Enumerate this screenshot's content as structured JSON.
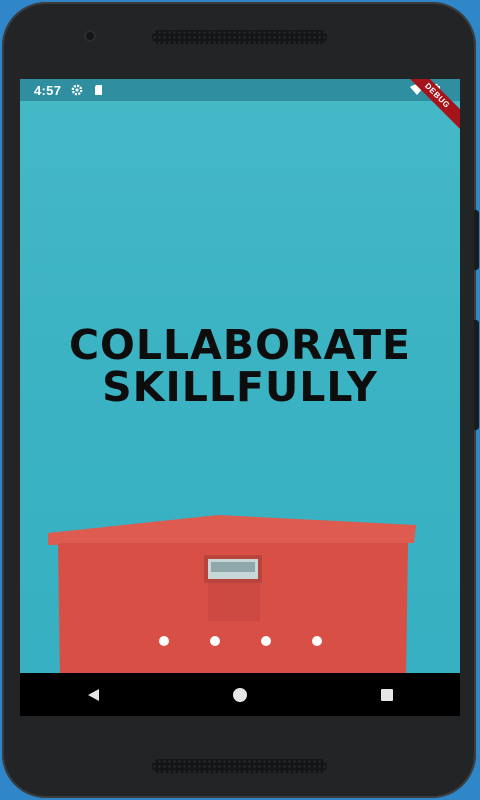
{
  "status_bar": {
    "time": "4:57",
    "icons": [
      "gear-icon",
      "sd-card-icon",
      "wifi-icon",
      "battery-icon"
    ]
  },
  "debug_banner": "DEBUG",
  "slide": {
    "line1": "COLLABORATE",
    "line2": "SKILLFULLY"
  },
  "page_indicator": {
    "count": 4
  },
  "nav_bar": {
    "buttons": [
      "back-icon",
      "home-icon",
      "recents-icon"
    ]
  },
  "colors": {
    "sky": "#3ab3c4",
    "building": "#d9534a",
    "status_bar": "#2f8fa0",
    "debug": "#a5141b"
  }
}
